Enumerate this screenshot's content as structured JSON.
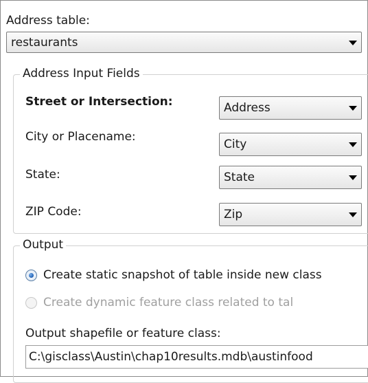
{
  "address_table": {
    "label": "Address table:",
    "value": "restaurants"
  },
  "address_input_fields": {
    "legend": "Address Input Fields",
    "fields": [
      {
        "label": "Street or Intersection:",
        "value": "Address"
      },
      {
        "label": "City or Placename:",
        "value": "City"
      },
      {
        "label": "State:",
        "value": "State"
      },
      {
        "label": "ZIP Code:",
        "value": "Zip"
      }
    ]
  },
  "output": {
    "legend": "Output",
    "option_static": "Create static snapshot of table inside new class",
    "option_dynamic": "Create dynamic feature class related to tal",
    "selected": "static",
    "path_label": "Output shapefile or feature class:",
    "path_value": "C:\\gisclass\\Austin\\chap10results.mdb\\austinfood"
  },
  "icons": [
    "chevron-down-icon"
  ]
}
